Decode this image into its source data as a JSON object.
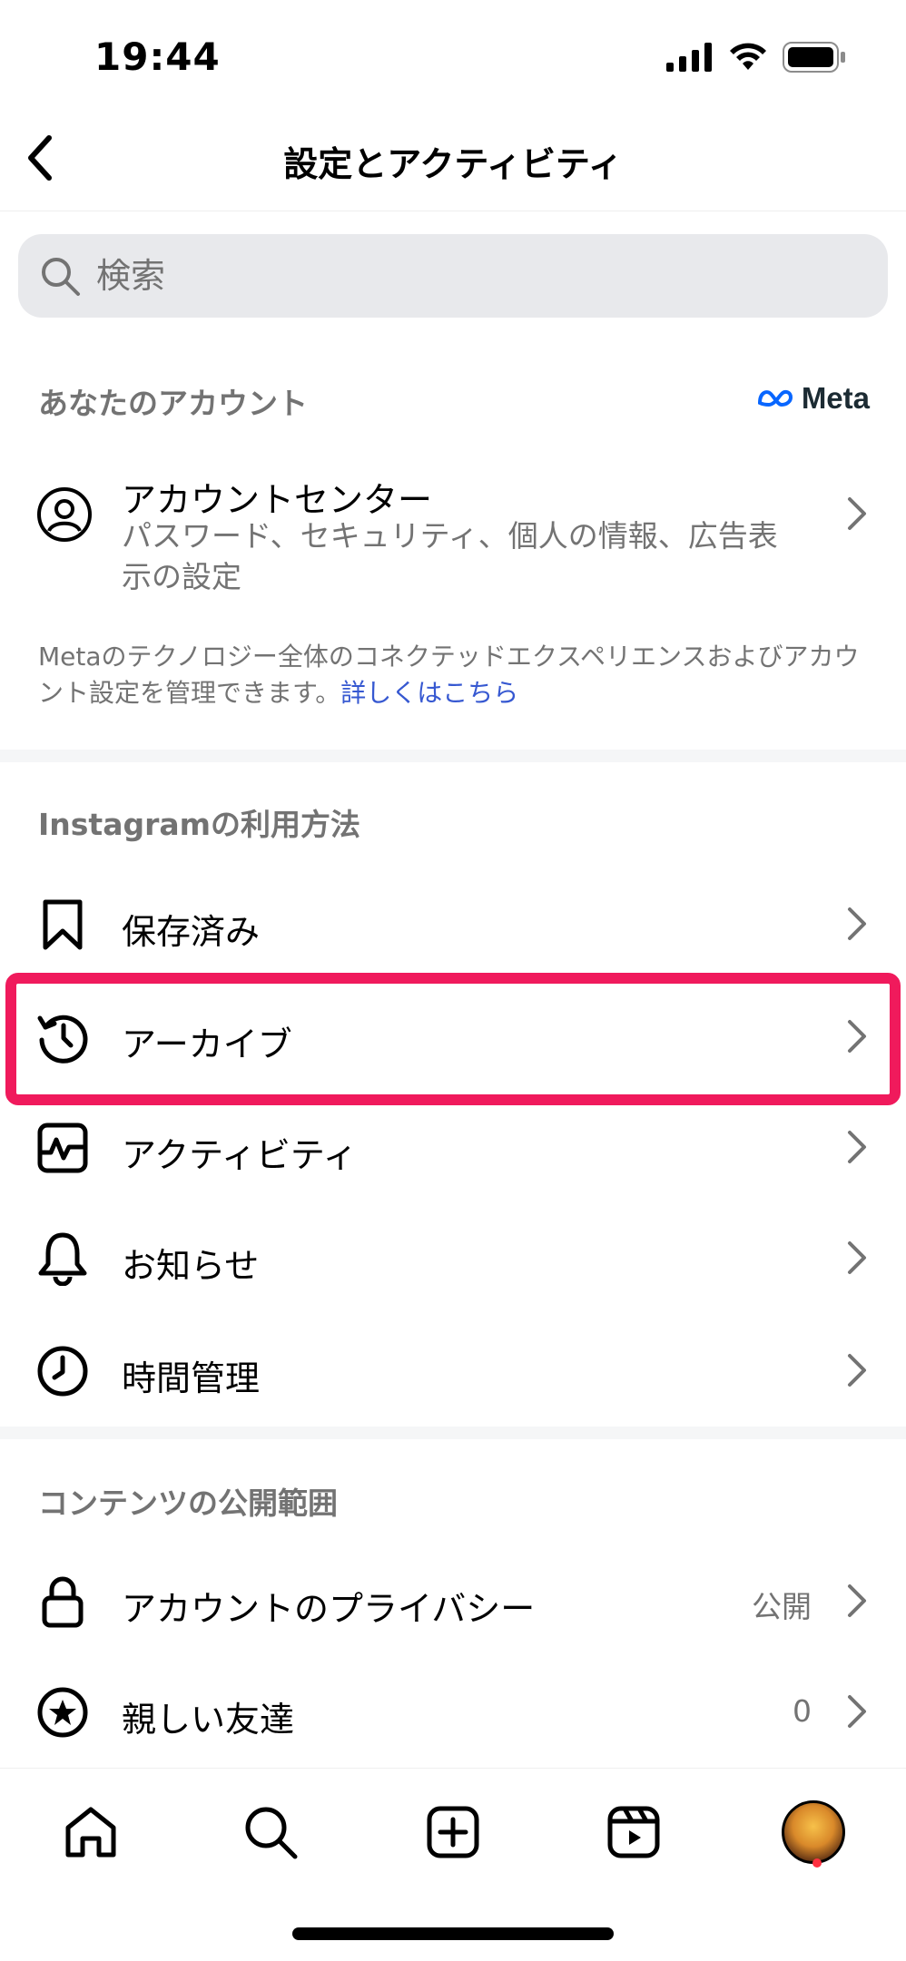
{
  "status_bar": {
    "time": "19:44"
  },
  "header": {
    "title": "設定とアクティビティ"
  },
  "search": {
    "placeholder": "検索"
  },
  "your_account": {
    "heading": "あなたのアカウント",
    "brand": "Meta",
    "account_center": {
      "title": "アカウントセンター",
      "description": "パスワード、セキュリティ、個人の情報、広告表示の設定"
    },
    "note": "Metaのテクノロジー全体のコネクテッドエクスペリエンスおよびアカウント設定を管理できます。",
    "note_link": "詳しくはこちら"
  },
  "how_you_use": {
    "heading": "Instagramの利用方法",
    "items": [
      {
        "label": "保存済み",
        "icon": "bookmark-icon"
      },
      {
        "label": "アーカイブ",
        "icon": "archive-history-icon"
      },
      {
        "label": "アクティビティ",
        "icon": "activity-icon"
      },
      {
        "label": "お知らせ",
        "icon": "bell-icon"
      },
      {
        "label": "時間管理",
        "icon": "clock-icon"
      }
    ]
  },
  "who_can_see": {
    "heading": "コンテンツの公開範囲",
    "items": [
      {
        "label": "アカウントのプライバシー",
        "value": "公開",
        "icon": "lock-icon"
      },
      {
        "label": "親しい友達",
        "value": "0",
        "icon": "star-circle-icon"
      }
    ]
  },
  "tab_bar": {
    "tabs": [
      "home-icon",
      "search-icon",
      "create-icon",
      "reels-icon",
      "profile-avatar"
    ]
  },
  "colors": {
    "highlight": "#f01a5c",
    "link": "#3658d1",
    "secondary_text": "#737373"
  }
}
